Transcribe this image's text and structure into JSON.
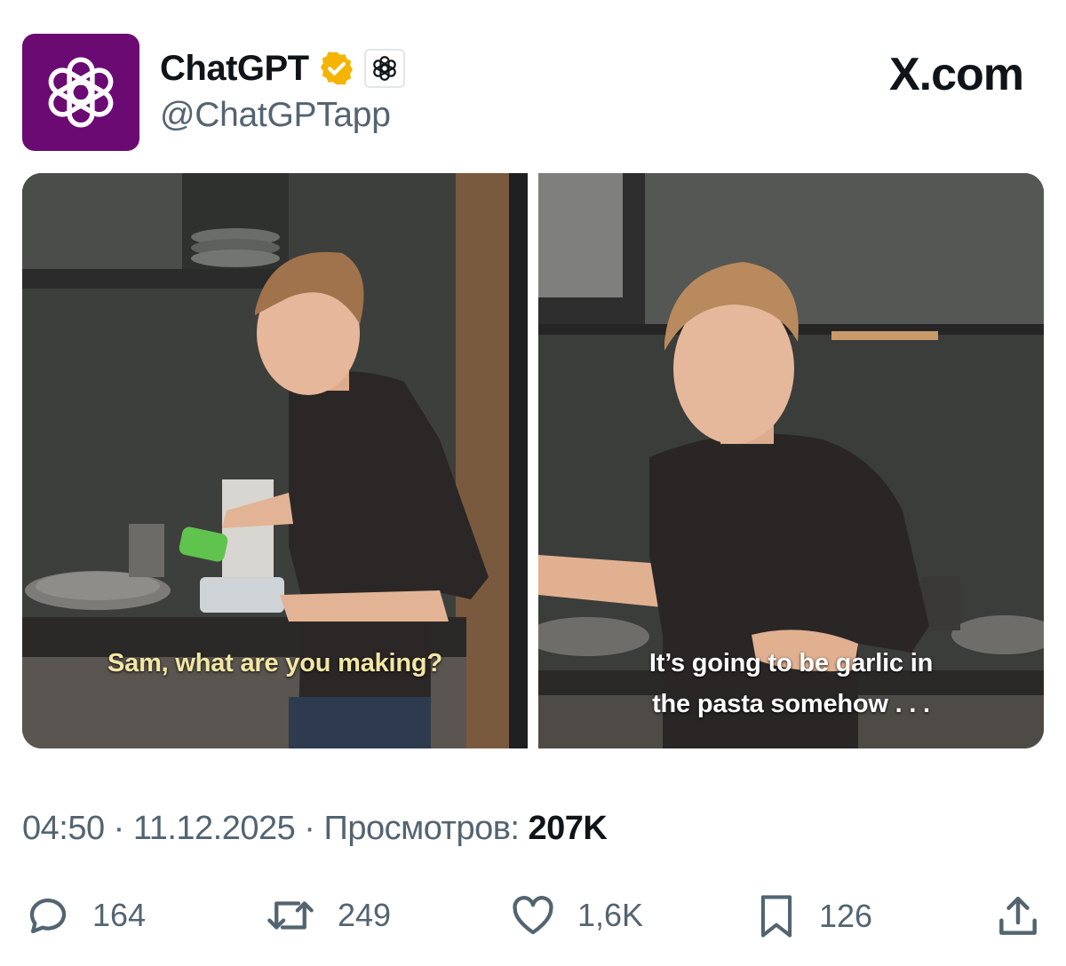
{
  "header": {
    "display_name": "ChatGPT",
    "handle": "@ChatGPTapp",
    "site": "X.com",
    "avatar_icon": "openai-logo-icon",
    "verified_icon": "verified-badge-icon",
    "affiliate_icon": "openai-affiliate-icon"
  },
  "media": {
    "left_caption": "Sam, what are you making?",
    "right_caption_line1": "It’s going to be garlic in",
    "right_caption_line2": "the pasta somehow . . ."
  },
  "meta": {
    "time": "04:50",
    "date": "11.12.2025",
    "views_label": "Просмотров:",
    "views_count": "207K",
    "separator": " · "
  },
  "actions": {
    "replies": "164",
    "reposts": "249",
    "likes": "1,6K",
    "bookmarks": "126"
  },
  "colors": {
    "avatar_bg": "#6b0a72",
    "verified": "#f4b400",
    "muted_text": "#536471",
    "primary_text": "#0f1419"
  }
}
